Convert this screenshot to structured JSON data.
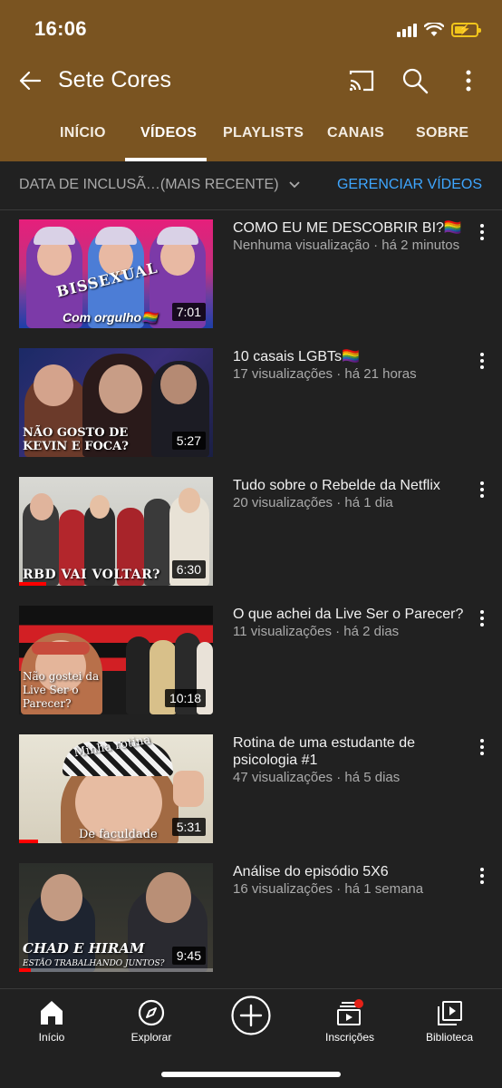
{
  "status_bar": {
    "time": "16:06",
    "battery_icon": "battery-charging-icon",
    "signal_icon": "cellular-signal-icon",
    "wifi_icon": "wifi-icon"
  },
  "app_bar": {
    "title": "Sete Cores",
    "background_color": "#7a5421"
  },
  "tabs": [
    {
      "label": "INÍCIO",
      "active": false
    },
    {
      "label": "VÍDEOS",
      "active": true
    },
    {
      "label": "PLAYLISTS",
      "active": false
    },
    {
      "label": "CANAIS",
      "active": false
    },
    {
      "label": "SOBRE",
      "active": false
    }
  ],
  "filter": {
    "sort_label": "DATA DE INCLUSÃ…(MAIS RECENTE)",
    "manage_label": "GERENCIAR VÍDEOS",
    "accent_color": "#3ea6ff"
  },
  "videos": [
    {
      "title": "COMO EU ME DESCOBRIR BI?🏳️‍🌈",
      "meta": "Nenhuma visualização · há 2 minutos",
      "duration": "7:01",
      "caption": "Com orgulho🏳️‍🌈",
      "overlay_text": "BISSEXUAL"
    },
    {
      "title": "10 casais LGBTs🏳️‍🌈",
      "meta": "17 visualizações · há 21 horas",
      "duration": "5:27",
      "caption": "NÃO GOSTO DE KEVIN E FOCA?"
    },
    {
      "title": "Tudo sobre o Rebelde da Netflix",
      "meta": "20 visualizações · há 1 dia",
      "duration": "6:30",
      "caption": "RBD VAI VOLTAR?"
    },
    {
      "title": "O que achei da Live Ser o Parecer?",
      "meta": "11 visualizações · há 2 dias",
      "duration": "10:18",
      "caption": "Não gostei da Live Ser o Parecer?"
    },
    {
      "title": "Rotina de uma estudante de psicologia #1",
      "meta": "47 visualizações · há 5 dias",
      "duration": "5:31",
      "caption": "De faculdade",
      "overlay_text": "Minha rotina"
    },
    {
      "title": "Análise do episódio 5X6",
      "meta": "16 visualizações · há 1 semana",
      "duration": "9:45",
      "caption": "CHAD E HIRAM",
      "caption_sub": "ESTÃO TRABALHANDO JUNTOS?"
    }
  ],
  "bottom_nav": [
    {
      "label": "Início",
      "icon": "home-icon",
      "active": true
    },
    {
      "label": "Explorar",
      "icon": "compass-icon",
      "active": false
    },
    {
      "label": "",
      "icon": "create-plus-icon",
      "active": false
    },
    {
      "label": "Inscrições",
      "icon": "subscriptions-icon",
      "active": false,
      "has_badge": true
    },
    {
      "label": "Biblioteca",
      "icon": "library-icon",
      "active": false
    }
  ]
}
